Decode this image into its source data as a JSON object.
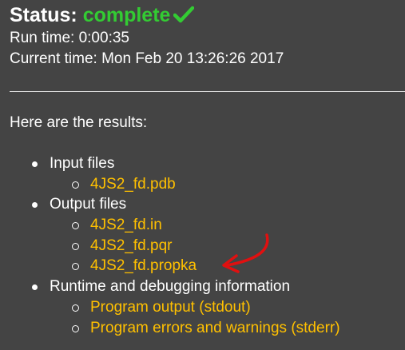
{
  "status": {
    "label": "Status:",
    "value": "complete",
    "icon": "check-icon",
    "value_color": "#33cc33"
  },
  "run_time": "Run time: 0:00:35",
  "current_time": "Current time: Mon Feb 20 13:26:26 2017",
  "results_intro": "Here are the results:",
  "sections": {
    "input": {
      "label": "Input files",
      "files": [
        "4JS2_fd.pdb"
      ]
    },
    "output": {
      "label": "Output files",
      "files": [
        "4JS2_fd.in",
        "4JS2_fd.pqr",
        "4JS2_fd.propka"
      ]
    },
    "runtime": {
      "label": "Runtime and debugging information",
      "files": [
        "Program output (stdout)",
        "Program errors and warnings (stderr)"
      ]
    }
  },
  "colors": {
    "background": "#444444",
    "link": "#ffc000",
    "annotation_arrow": "#e01010"
  },
  "annotation": {
    "icon": "red-arrow-icon",
    "points_to": "4JS2_fd.propka"
  }
}
